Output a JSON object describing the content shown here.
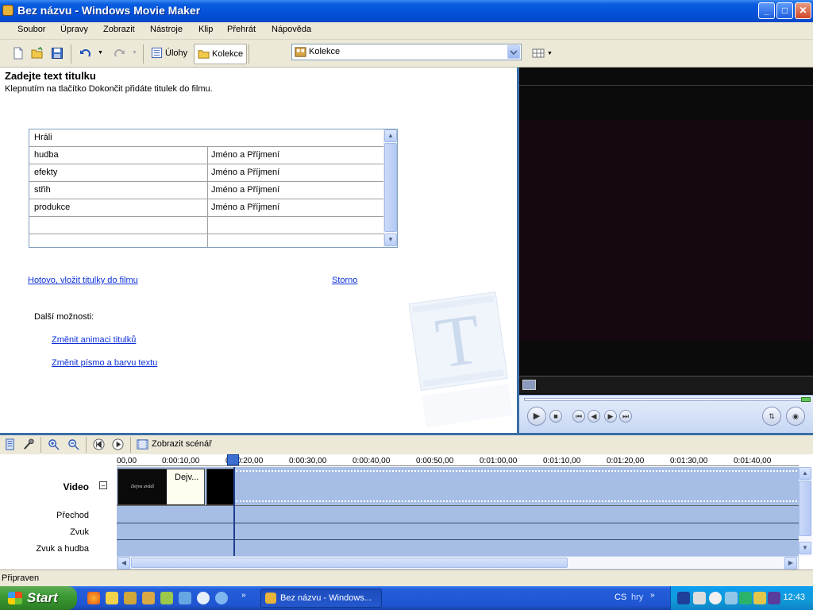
{
  "window": {
    "title": "Bez názvu - Windows Movie Maker",
    "min": "_",
    "max": "□",
    "close": "✕"
  },
  "menu": [
    "Soubor",
    "Úpravy",
    "Zobrazit",
    "Nástroje",
    "Klip",
    "Přehrát",
    "Nápověda"
  ],
  "toolbar": {
    "tasks_label": "Úlohy",
    "collections_label": "Kolekce",
    "collection_combo": "Kolekce"
  },
  "taskpane": {
    "heading": "Zadejte text titulku",
    "subtext": "Klepnutím na tlačítko Dokončit přidáte titulek do filmu.",
    "credits_header": "Hráli",
    "credits_rows": [
      {
        "role": "hudba",
        "name": "Jméno a Příjmení"
      },
      {
        "role": "efekty",
        "name": "Jméno a Příjmení"
      },
      {
        "role": "střih",
        "name": "Jméno a Příjmení"
      },
      {
        "role": "produkce",
        "name": "Jméno a Příjmení"
      },
      {
        "role": "",
        "name": ""
      },
      {
        "role": "",
        "name": ""
      }
    ],
    "done_link": "Hotovo, vložit titulky do filmu",
    "cancel_link": "Storno",
    "more_options": "Další možnosti:",
    "change_animation": "Změnit animaci titulků",
    "change_font": "Změnit písmo a barvu textu",
    "watermark_letter": "T"
  },
  "timeline": {
    "storyboard_label": "Zobrazit scénář",
    "ruler": [
      "00,00",
      "0:00:10,00",
      "0:00:20,00",
      "0:00:30,00",
      "0:00:40,00",
      "0:00:50,00",
      "0:01:00,00",
      "0:01:10,00",
      "0:01:20,00",
      "0:01:30,00",
      "0:01:40,00"
    ],
    "tracks": {
      "video": "Video",
      "transition": "Přechod",
      "audio": "Zvuk",
      "audio_music": "Zvuk a hudba"
    },
    "clip1_thumb": "Dejva uvádí",
    "clip1_name": "Dejv..."
  },
  "status": "Připraven",
  "taskbar": {
    "start": "Start",
    "task": "Bez názvu - Windows...",
    "lang": "CS",
    "toolbar_label": "hry",
    "clock": "12:43"
  },
  "colors": {
    "titlebar": "#0a5ee0",
    "link": "#0b2fd9",
    "track": "#a6bee6",
    "taskbar": "#245edb",
    "start": "#3c9b34"
  }
}
